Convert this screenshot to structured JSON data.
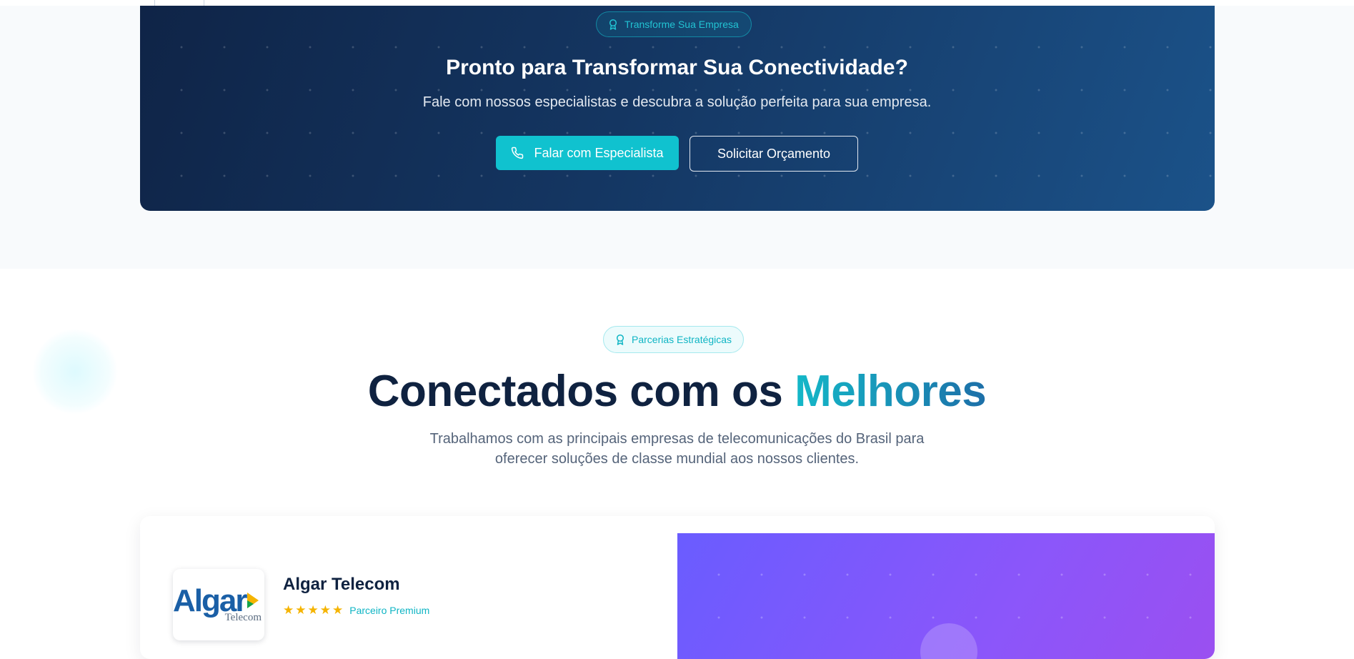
{
  "cta": {
    "badge": "Transforme Sua Empresa",
    "title": "Pronto para Transformar Sua Conectividade?",
    "subtitle": "Fale com nossos especialistas e descubra a solução perfeita para sua empresa.",
    "primary_button": "Falar com Especialista",
    "secondary_button": "Solicitar Orçamento"
  },
  "partners": {
    "badge": "Parcerias Estratégicas",
    "title_main": "Conectados com os ",
    "title_accent": "Melhores",
    "description_line1": "Trabalhamos com as principais empresas de telecomunicações do Brasil para",
    "description_line2": "oferecer soluções de classe mundial aos nossos clientes.",
    "card": {
      "logo_text": "Algar",
      "logo_subtext": "Telecom",
      "name": "Algar Telecom",
      "rating": 5,
      "tier": "Parceiro Premium"
    }
  },
  "colors": {
    "accent": "#10c2cf",
    "navy": "#0f2240",
    "cta_gradient_start": "#0f2447",
    "cta_gradient_end": "#1b5289",
    "card_visual": "#7b59fb",
    "star": "#f5b400"
  },
  "icons": {
    "badge_icon": "award-icon",
    "call_icon": "phone-icon"
  }
}
